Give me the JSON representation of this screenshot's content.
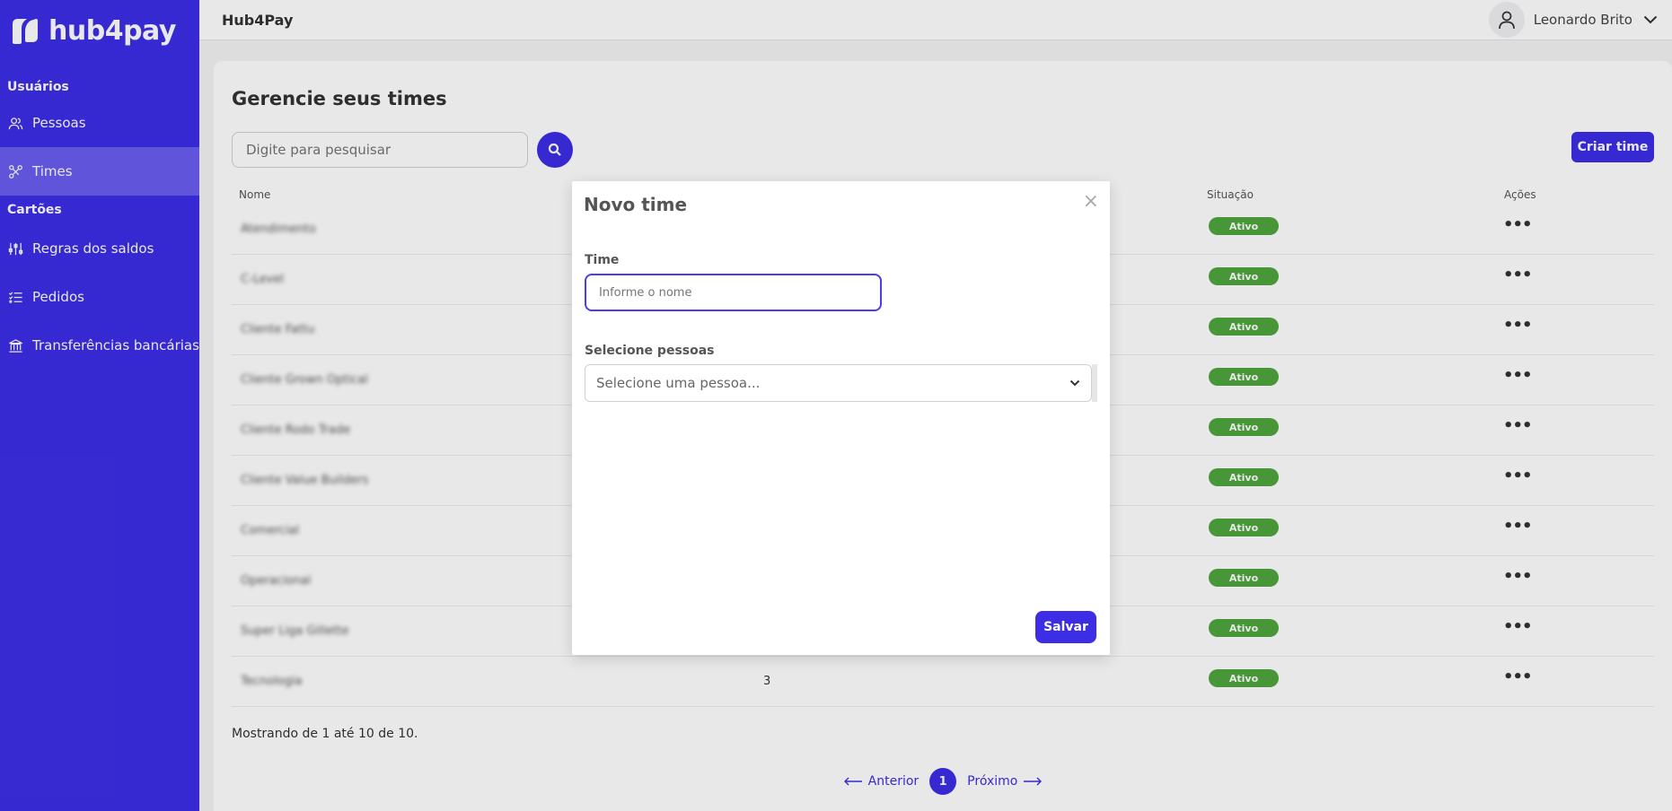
{
  "sidebar": {
    "logo_text": "hub4pay",
    "sections": [
      {
        "title": "Usuários"
      },
      {
        "title": "Cartões"
      }
    ],
    "items": [
      {
        "label": "Pessoas",
        "icon": "people-icon"
      },
      {
        "label": "Times",
        "icon": "team-icon"
      },
      {
        "label": "Regras dos saldos",
        "icon": "sliders-icon"
      },
      {
        "label": "Pedidos",
        "icon": "list-icon"
      },
      {
        "label": "Transferências bancárias",
        "icon": "bank-icon"
      }
    ],
    "colors": {
      "background": "#3d2ee6",
      "active": "#6a5ef0"
    }
  },
  "header": {
    "title": "Hub4Pay",
    "user_name": "Leonardo Brito"
  },
  "main": {
    "title": "Gerencie seus times",
    "search_placeholder": "Digite para pesquisar",
    "create_button": "Criar time",
    "columns": [
      "Nome",
      "Situação",
      "Ações"
    ],
    "rows": [
      {
        "name": "Atendimento",
        "count": "",
        "status": "Ativo"
      },
      {
        "name": "C-Level",
        "count": "",
        "status": "Ativo"
      },
      {
        "name": "Cliente Fattu",
        "count": "",
        "status": "Ativo"
      },
      {
        "name": "Cliente Grown Optical",
        "count": "",
        "status": "Ativo"
      },
      {
        "name": "Cliente Rodo Trade",
        "count": "",
        "status": "Ativo"
      },
      {
        "name": "Cliente Value Builders",
        "count": "",
        "status": "Ativo"
      },
      {
        "name": "Comercial",
        "count": "",
        "status": "Ativo"
      },
      {
        "name": "Operacional",
        "count": "",
        "status": "Ativo"
      },
      {
        "name": "Super Liga Gillette",
        "count": "",
        "status": "Ativo"
      },
      {
        "name": "Tecnologia",
        "count": "3",
        "status": "Ativo"
      }
    ],
    "actions_label": "•••",
    "showing": "Mostrando de 1 até 10 de 10.",
    "pagination": {
      "prev": "Anterior",
      "page": "1",
      "next": "Próximo"
    },
    "status_color": "#4fa63f"
  },
  "modal": {
    "title": "Novo time",
    "close": "×",
    "team_label": "Time",
    "team_placeholder": "Informe o nome",
    "people_label": "Selecione pessoas",
    "people_placeholder": "Selecione uma pessoa...",
    "save": "Salvar"
  }
}
